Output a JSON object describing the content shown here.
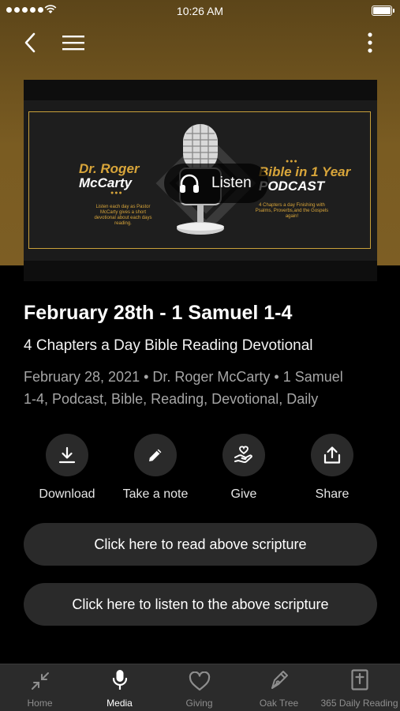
{
  "status_bar": {
    "time": "10:26 AM"
  },
  "artwork": {
    "left_title_line1": "Dr. Roger",
    "left_title_line2": "McCarty",
    "left_blurb": "Listen each day as Pastor McCarty gives a short devotional about each days reading.",
    "right_title_line1": "Bible in 1 Year",
    "right_title_line2": "PODCAST",
    "right_blurb": "4 Chapters a day Finishing with Psalms, Proverbs,and the Gospels again!",
    "listen_label": "Listen"
  },
  "episode": {
    "title": "February 28th - 1 Samuel 1-4",
    "series": "4 Chapters a Day Bible Reading Devotional",
    "meta_line1": "February 28, 2021 • Dr. Roger McCarty • 1 Samuel",
    "meta_line2": "1-4, Podcast, Bible, Reading, Devotional, Daily"
  },
  "actions": [
    {
      "label": "Download",
      "icon": "download-icon"
    },
    {
      "label": "Take a note",
      "icon": "pencil-icon"
    },
    {
      "label": "Give",
      "icon": "give-hand-heart-icon"
    },
    {
      "label": "Share",
      "icon": "share-icon"
    }
  ],
  "buttons": {
    "read_scripture": "Click here to read above scripture",
    "listen_scripture": "Click here to listen to the above scripture"
  },
  "tabs": [
    {
      "label": "Home",
      "icon": "compress-arrows-icon",
      "active": false
    },
    {
      "label": "Media",
      "icon": "microphone-icon",
      "active": true
    },
    {
      "label": "Giving",
      "icon": "heart-icon",
      "active": false
    },
    {
      "label": "Oak Tree",
      "icon": "pen-nib-icon",
      "active": false
    },
    {
      "label": "365 Daily Reading",
      "icon": "bible-cross-icon",
      "active": false
    }
  ],
  "colors": {
    "accent_gold": "#d8a53a",
    "hero_brown": "#7a5c22",
    "surface": "#2a2a2a"
  }
}
